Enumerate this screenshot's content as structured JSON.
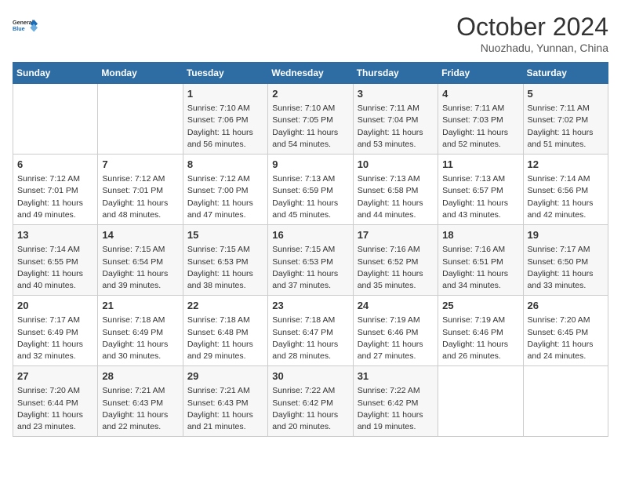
{
  "logo": {
    "line1": "General",
    "line2": "Blue"
  },
  "calendar": {
    "title": "October 2024",
    "subtitle": "Nuozhadu, Yunnan, China"
  },
  "headers": [
    "Sunday",
    "Monday",
    "Tuesday",
    "Wednesday",
    "Thursday",
    "Friday",
    "Saturday"
  ],
  "weeks": [
    [
      {
        "day": "",
        "sunrise": "",
        "sunset": "",
        "daylight": ""
      },
      {
        "day": "",
        "sunrise": "",
        "sunset": "",
        "daylight": ""
      },
      {
        "day": "1",
        "sunrise": "Sunrise: 7:10 AM",
        "sunset": "Sunset: 7:06 PM",
        "daylight": "Daylight: 11 hours and 56 minutes."
      },
      {
        "day": "2",
        "sunrise": "Sunrise: 7:10 AM",
        "sunset": "Sunset: 7:05 PM",
        "daylight": "Daylight: 11 hours and 54 minutes."
      },
      {
        "day": "3",
        "sunrise": "Sunrise: 7:11 AM",
        "sunset": "Sunset: 7:04 PM",
        "daylight": "Daylight: 11 hours and 53 minutes."
      },
      {
        "day": "4",
        "sunrise": "Sunrise: 7:11 AM",
        "sunset": "Sunset: 7:03 PM",
        "daylight": "Daylight: 11 hours and 52 minutes."
      },
      {
        "day": "5",
        "sunrise": "Sunrise: 7:11 AM",
        "sunset": "Sunset: 7:02 PM",
        "daylight": "Daylight: 11 hours and 51 minutes."
      }
    ],
    [
      {
        "day": "6",
        "sunrise": "Sunrise: 7:12 AM",
        "sunset": "Sunset: 7:01 PM",
        "daylight": "Daylight: 11 hours and 49 minutes."
      },
      {
        "day": "7",
        "sunrise": "Sunrise: 7:12 AM",
        "sunset": "Sunset: 7:01 PM",
        "daylight": "Daylight: 11 hours and 48 minutes."
      },
      {
        "day": "8",
        "sunrise": "Sunrise: 7:12 AM",
        "sunset": "Sunset: 7:00 PM",
        "daylight": "Daylight: 11 hours and 47 minutes."
      },
      {
        "day": "9",
        "sunrise": "Sunrise: 7:13 AM",
        "sunset": "Sunset: 6:59 PM",
        "daylight": "Daylight: 11 hours and 45 minutes."
      },
      {
        "day": "10",
        "sunrise": "Sunrise: 7:13 AM",
        "sunset": "Sunset: 6:58 PM",
        "daylight": "Daylight: 11 hours and 44 minutes."
      },
      {
        "day": "11",
        "sunrise": "Sunrise: 7:13 AM",
        "sunset": "Sunset: 6:57 PM",
        "daylight": "Daylight: 11 hours and 43 minutes."
      },
      {
        "day": "12",
        "sunrise": "Sunrise: 7:14 AM",
        "sunset": "Sunset: 6:56 PM",
        "daylight": "Daylight: 11 hours and 42 minutes."
      }
    ],
    [
      {
        "day": "13",
        "sunrise": "Sunrise: 7:14 AM",
        "sunset": "Sunset: 6:55 PM",
        "daylight": "Daylight: 11 hours and 40 minutes."
      },
      {
        "day": "14",
        "sunrise": "Sunrise: 7:15 AM",
        "sunset": "Sunset: 6:54 PM",
        "daylight": "Daylight: 11 hours and 39 minutes."
      },
      {
        "day": "15",
        "sunrise": "Sunrise: 7:15 AM",
        "sunset": "Sunset: 6:53 PM",
        "daylight": "Daylight: 11 hours and 38 minutes."
      },
      {
        "day": "16",
        "sunrise": "Sunrise: 7:15 AM",
        "sunset": "Sunset: 6:53 PM",
        "daylight": "Daylight: 11 hours and 37 minutes."
      },
      {
        "day": "17",
        "sunrise": "Sunrise: 7:16 AM",
        "sunset": "Sunset: 6:52 PM",
        "daylight": "Daylight: 11 hours and 35 minutes."
      },
      {
        "day": "18",
        "sunrise": "Sunrise: 7:16 AM",
        "sunset": "Sunset: 6:51 PM",
        "daylight": "Daylight: 11 hours and 34 minutes."
      },
      {
        "day": "19",
        "sunrise": "Sunrise: 7:17 AM",
        "sunset": "Sunset: 6:50 PM",
        "daylight": "Daylight: 11 hours and 33 minutes."
      }
    ],
    [
      {
        "day": "20",
        "sunrise": "Sunrise: 7:17 AM",
        "sunset": "Sunset: 6:49 PM",
        "daylight": "Daylight: 11 hours and 32 minutes."
      },
      {
        "day": "21",
        "sunrise": "Sunrise: 7:18 AM",
        "sunset": "Sunset: 6:49 PM",
        "daylight": "Daylight: 11 hours and 30 minutes."
      },
      {
        "day": "22",
        "sunrise": "Sunrise: 7:18 AM",
        "sunset": "Sunset: 6:48 PM",
        "daylight": "Daylight: 11 hours and 29 minutes."
      },
      {
        "day": "23",
        "sunrise": "Sunrise: 7:18 AM",
        "sunset": "Sunset: 6:47 PM",
        "daylight": "Daylight: 11 hours and 28 minutes."
      },
      {
        "day": "24",
        "sunrise": "Sunrise: 7:19 AM",
        "sunset": "Sunset: 6:46 PM",
        "daylight": "Daylight: 11 hours and 27 minutes."
      },
      {
        "day": "25",
        "sunrise": "Sunrise: 7:19 AM",
        "sunset": "Sunset: 6:46 PM",
        "daylight": "Daylight: 11 hours and 26 minutes."
      },
      {
        "day": "26",
        "sunrise": "Sunrise: 7:20 AM",
        "sunset": "Sunset: 6:45 PM",
        "daylight": "Daylight: 11 hours and 24 minutes."
      }
    ],
    [
      {
        "day": "27",
        "sunrise": "Sunrise: 7:20 AM",
        "sunset": "Sunset: 6:44 PM",
        "daylight": "Daylight: 11 hours and 23 minutes."
      },
      {
        "day": "28",
        "sunrise": "Sunrise: 7:21 AM",
        "sunset": "Sunset: 6:43 PM",
        "daylight": "Daylight: 11 hours and 22 minutes."
      },
      {
        "day": "29",
        "sunrise": "Sunrise: 7:21 AM",
        "sunset": "Sunset: 6:43 PM",
        "daylight": "Daylight: 11 hours and 21 minutes."
      },
      {
        "day": "30",
        "sunrise": "Sunrise: 7:22 AM",
        "sunset": "Sunset: 6:42 PM",
        "daylight": "Daylight: 11 hours and 20 minutes."
      },
      {
        "day": "31",
        "sunrise": "Sunrise: 7:22 AM",
        "sunset": "Sunset: 6:42 PM",
        "daylight": "Daylight: 11 hours and 19 minutes."
      },
      {
        "day": "",
        "sunrise": "",
        "sunset": "",
        "daylight": ""
      },
      {
        "day": "",
        "sunrise": "",
        "sunset": "",
        "daylight": ""
      }
    ]
  ]
}
